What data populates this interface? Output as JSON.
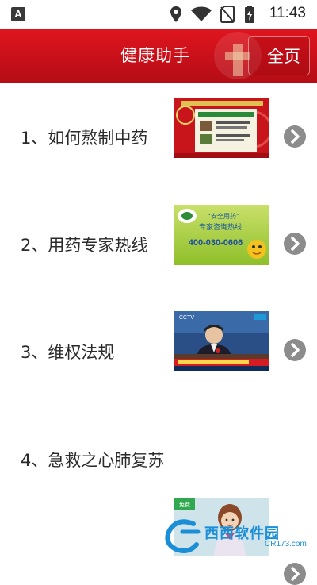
{
  "status_bar": {
    "app_badge": "A",
    "time": "11:43"
  },
  "header": {
    "title": "健康助手",
    "home_label": "全页"
  },
  "items": [
    {
      "label": "1、如何熬制中药",
      "thumbnail": "decoction-guide-image"
    },
    {
      "label": "2、用药专家热线",
      "thumbnail": "hotline-banner-image",
      "banner_line1": "“安全用药”",
      "banner_line2": "专家咨询热线",
      "banner_phone": "400-030-0606"
    },
    {
      "label": "3、维权法规",
      "thumbnail": "press-conference-image",
      "news_logo": "CCTV"
    },
    {
      "label": "4、急救之心肺复苏",
      "thumbnail": "cpr-illustration-image",
      "tag": "免费"
    }
  ],
  "watermark": {
    "text": "西西软件园",
    "sub": "CR173.com"
  },
  "colors": {
    "header_red": "#d0121b",
    "chevron_gray": "#8c8c8c",
    "divider": "#e3e3e3"
  }
}
